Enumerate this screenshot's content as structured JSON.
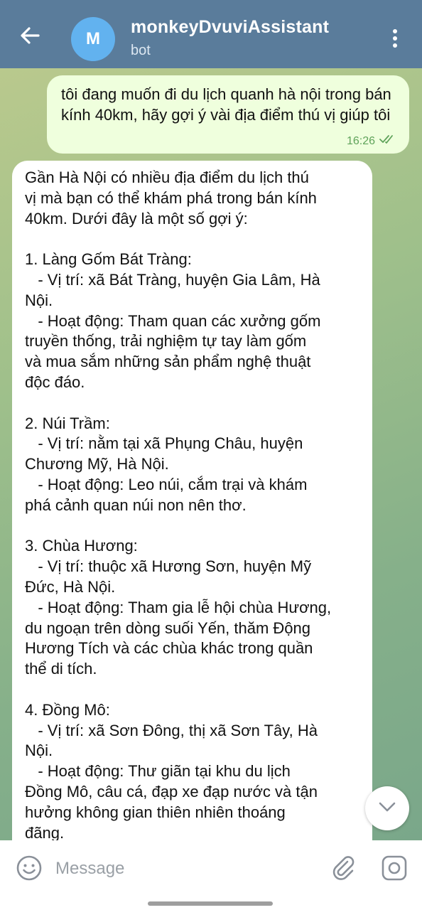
{
  "header": {
    "avatar_letter": "M",
    "title": "monkeyDvuviAssistant",
    "subtitle": "bot"
  },
  "messages": {
    "outgoing": {
      "text": "tôi đang muốn đi du lịch quanh hà nội trong bán kính 40km, hãy gợi ý vài địa điểm thú vị giúp tôi",
      "time": "16:26",
      "status": "read"
    },
    "incoming": {
      "text": "Gần Hà Nội có nhiều địa điểm du lịch thú\nvị mà bạn có thể khám phá trong bán kính\n40km. Dưới đây là một số gợi ý:\n\n1. Làng Gốm Bát Tràng:\n   - Vị trí: xã Bát Tràng, huyện Gia Lâm, Hà\nNội.\n   - Hoạt động: Tham quan các xưởng gốm\ntruyền thống, trải nghiệm tự tay làm gốm\nvà mua sắm những sản phẩm nghệ thuật\nđộc đáo.\n\n2. Núi Trầm:\n   - Vị trí: nằm tại xã Phụng Châu, huyện\nChương Mỹ, Hà Nội.\n   - Hoạt động: Leo núi, cắm trại và khám\nphá cảnh quan núi non nên thơ.\n\n3. Chùa Hương:\n   - Vị trí: thuộc xã Hương Sơn, huyện Mỹ\nĐức, Hà Nội.\n   - Hoạt động: Tham gia lễ hội chùa Hương,\ndu ngoạn trên dòng suối Yến, thăm Động\nHương Tích và các chùa khác trong quần\nthể di tích.\n\n4. Đồng Mô:\n   - Vị trí: xã Sơn Đông, thị xã Sơn Tây, Hà\nNội.\n   - Hoạt động: Thư giãn tại khu du lịch\nĐồng Mô, câu cá, đạp xe đạp nước và tận\nhưởng không gian thiên nhiên thoáng\nđãng."
    }
  },
  "composer": {
    "placeholder": "Message"
  },
  "colors": {
    "header_bg": "#5a7c9b",
    "outgoing_bubble": "#efffdd",
    "incoming_bubble": "#ffffff",
    "avatar_bg": "#62b2ef",
    "read_check": "#5fa35a"
  },
  "icons": [
    "back-arrow-icon",
    "more-vertical-icon",
    "double-check-icon",
    "chevron-down-icon",
    "emoji-icon",
    "paperclip-icon",
    "camera-icon"
  ]
}
